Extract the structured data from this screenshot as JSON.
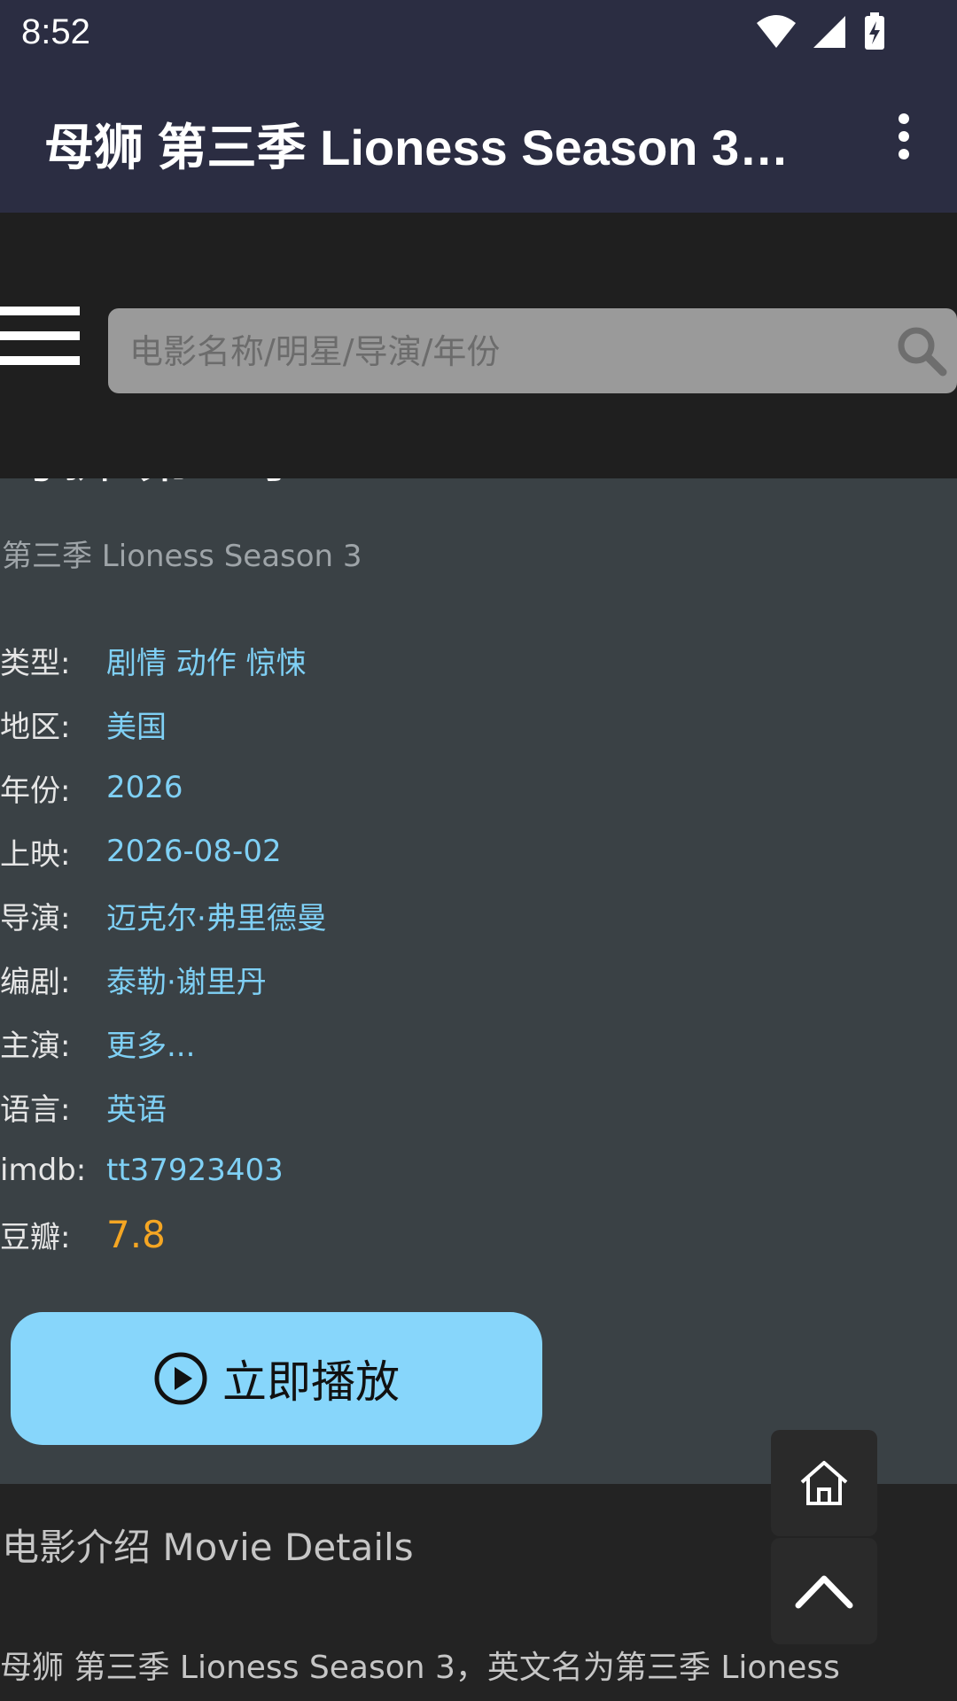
{
  "status_bar": {
    "time": "8:52",
    "icons": [
      "wifi-icon",
      "cell-signal-icon",
      "battery-charging-icon"
    ]
  },
  "app_bar": {
    "title": "母狮 第三季 Lioness Season 3…",
    "overflow_icon": "more-vert-icon"
  },
  "search": {
    "placeholder": "电影名称/明星/导演/年份",
    "value": "",
    "icon": "search-icon",
    "menu_icon": "hamburger-icon"
  },
  "movie": {
    "title_partial": "母狮 第三季 Lioness Season 3",
    "subtitle": "第三季 Lioness Season 3",
    "info": [
      {
        "label": "类型:",
        "value": "剧情 动作 惊悚"
      },
      {
        "label": "地区:",
        "value": "美国"
      },
      {
        "label": "年份:",
        "value": "2026"
      },
      {
        "label": "上映:",
        "value": "2026-08-02"
      },
      {
        "label": "导演:",
        "value": "迈克尔·弗里德曼"
      },
      {
        "label": "编剧:",
        "value": "泰勒·谢里丹"
      },
      {
        "label": "主演:",
        "value": "更多..."
      },
      {
        "label": "语言:",
        "value": "英语"
      },
      {
        "label": "imdb:",
        "value": "tt37923403"
      },
      {
        "label": "豆瓣:",
        "value": "7.8"
      }
    ],
    "play_button_label": "立即播放"
  },
  "details": {
    "heading": "电影介绍 Movie Details",
    "text": "母狮 第三季 Lioness Season 3，英文名为第三季 Lioness"
  },
  "fabs": {
    "home_icon": "home-icon",
    "top_icon": "chevron-up-icon"
  },
  "colors": {
    "app_bar": "#2b2d42",
    "search_area": "#1f1f1f",
    "content_bg": "#3a4145",
    "link": "#7fd0f5",
    "score": "#f5a623",
    "play_button": "#87d6fb"
  }
}
